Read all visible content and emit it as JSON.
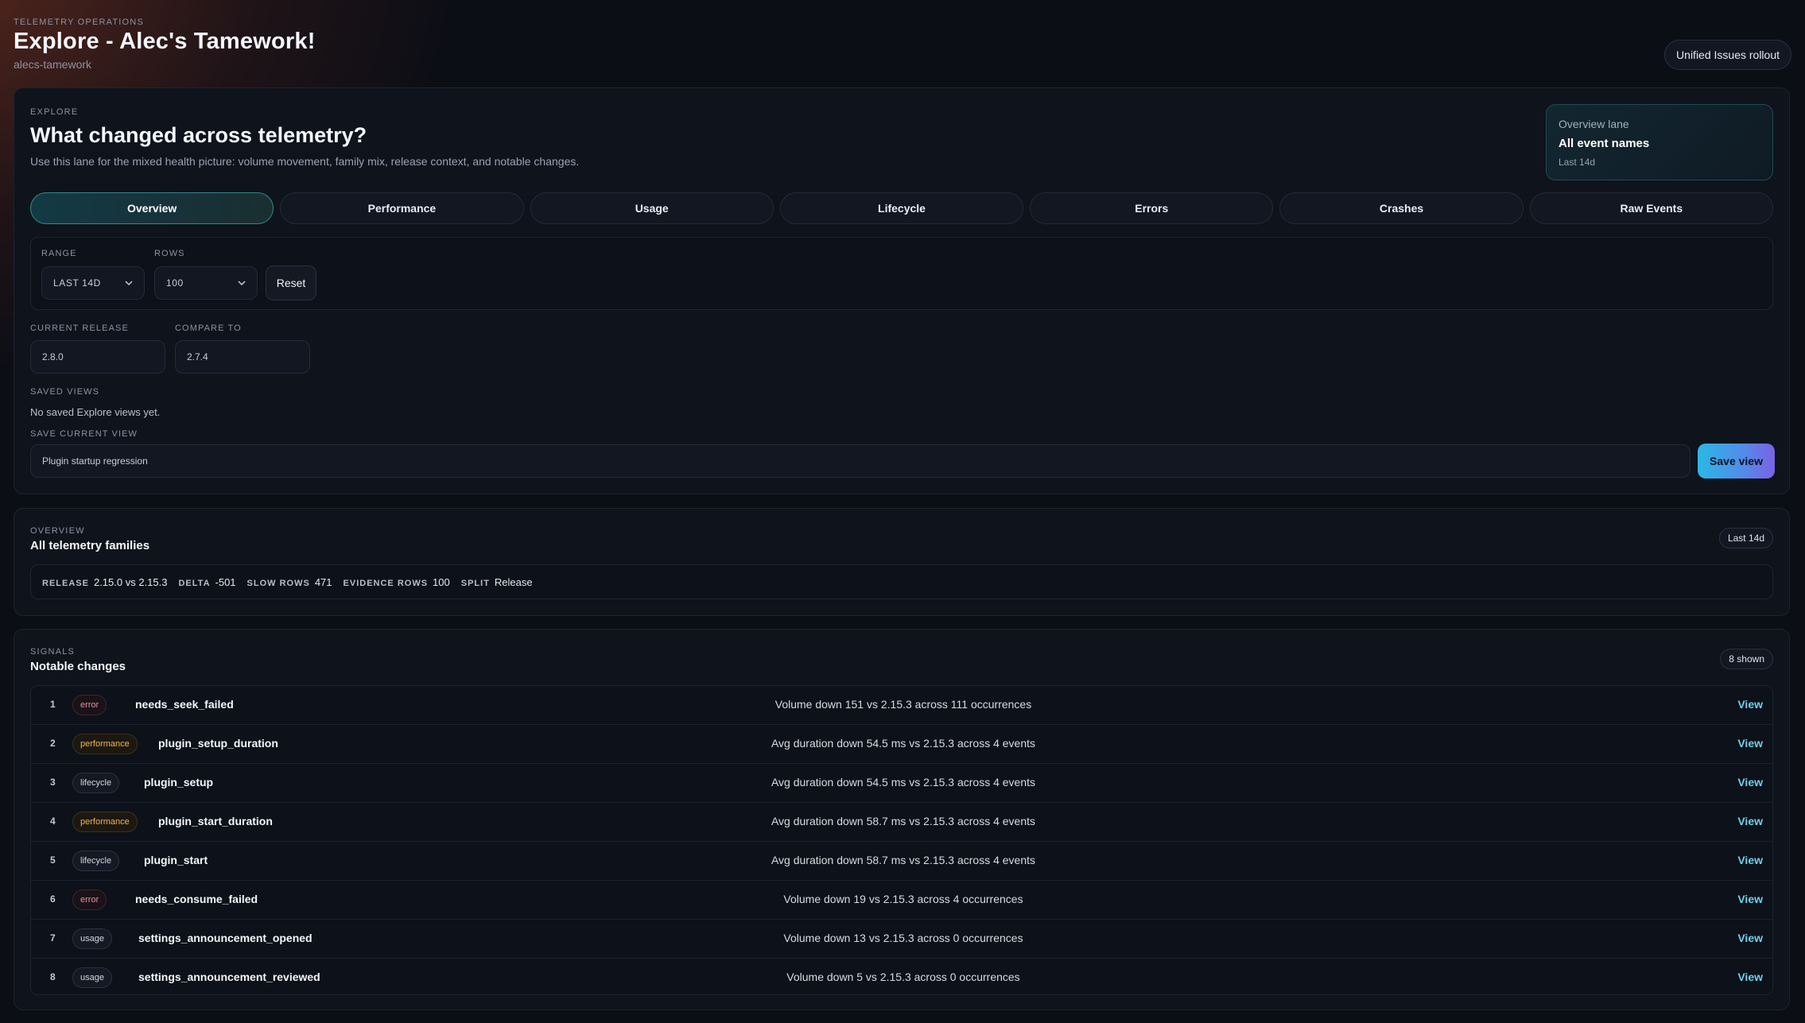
{
  "header": {
    "eyebrow": "TELEMETRY OPERATIONS",
    "title": "Explore - Alec's Tamework!",
    "slug": "alecs-tamework",
    "rollout_label": "Unified Issues rollout"
  },
  "explore": {
    "eyebrow": "EXPLORE",
    "title": "What changed across telemetry?",
    "description": "Use this lane for the mixed health picture: volume movement, family mix, release context, and notable changes.",
    "lane": {
      "label": "Overview lane",
      "value": "All event names",
      "range": "Last 14d"
    },
    "tabs": [
      {
        "label": "Overview",
        "active": true
      },
      {
        "label": "Performance",
        "active": false
      },
      {
        "label": "Usage",
        "active": false
      },
      {
        "label": "Lifecycle",
        "active": false
      },
      {
        "label": "Errors",
        "active": false
      },
      {
        "label": "Crashes",
        "active": false
      },
      {
        "label": "Raw Events",
        "active": false
      }
    ],
    "filters": {
      "range_label": "RANGE",
      "range_value": "LAST 14D",
      "rows_label": "ROWS",
      "rows_value": "100",
      "reset_label": "Reset"
    },
    "release": {
      "current_label": "CURRENT RELEASE",
      "current_value": "2.8.0",
      "compare_label": "COMPARE TO",
      "compare_value": "2.7.4"
    },
    "saved_views": {
      "label": "SAVED VIEWS",
      "empty_text": "No saved Explore views yet.",
      "save_label": "SAVE CURRENT VIEW",
      "save_input_value": "Plugin startup regression",
      "save_button": "Save view"
    }
  },
  "overview": {
    "eyebrow": "OVERVIEW",
    "title": "All telemetry families",
    "range_pill": "Last 14d",
    "stats": [
      {
        "key": "RELEASE",
        "value": "2.15.0 vs 2.15.3"
      },
      {
        "key": "DELTA",
        "value": "-501"
      },
      {
        "key": "SLOW ROWS",
        "value": "471"
      },
      {
        "key": "EVIDENCE ROWS",
        "value": "100"
      },
      {
        "key": "SPLIT",
        "value": "Release"
      }
    ]
  },
  "signals": {
    "eyebrow": "SIGNALS",
    "title": "Notable changes",
    "count_pill": "8 shown",
    "view_label": "View",
    "rows": [
      {
        "num": "1",
        "type": "error",
        "name": "needs_seek_failed",
        "desc": "Volume down 151 vs 2.15.3 across 111 occurrences"
      },
      {
        "num": "2",
        "type": "performance",
        "name": "plugin_setup_duration",
        "desc": "Avg duration down 54.5 ms vs 2.15.3 across 4 events"
      },
      {
        "num": "3",
        "type": "lifecycle",
        "name": "plugin_setup",
        "desc": "Avg duration down 54.5 ms vs 2.15.3 across 4 events"
      },
      {
        "num": "4",
        "type": "performance",
        "name": "plugin_start_duration",
        "desc": "Avg duration down 58.7 ms vs 2.15.3 across 4 events"
      },
      {
        "num": "5",
        "type": "lifecycle",
        "name": "plugin_start",
        "desc": "Avg duration down 58.7 ms vs 2.15.3 across 4 events"
      },
      {
        "num": "6",
        "type": "error",
        "name": "needs_consume_failed",
        "desc": "Volume down 19 vs 2.15.3 across 4 occurrences"
      },
      {
        "num": "7",
        "type": "usage",
        "name": "settings_announcement_opened",
        "desc": "Volume down 13 vs 2.15.3 across 0 occurrences"
      },
      {
        "num": "8",
        "type": "usage",
        "name": "settings_announcement_reviewed",
        "desc": "Volume down 5 vs 2.15.3 across 0 occurrences"
      }
    ]
  },
  "colors": {
    "accent_cyan": "#6fd0ee",
    "error_badge": "#e58aa6",
    "performance_badge": "#f0b54e",
    "save_gradient_start": "#2bb7e6",
    "save_gradient_end": "#7a62e6"
  }
}
